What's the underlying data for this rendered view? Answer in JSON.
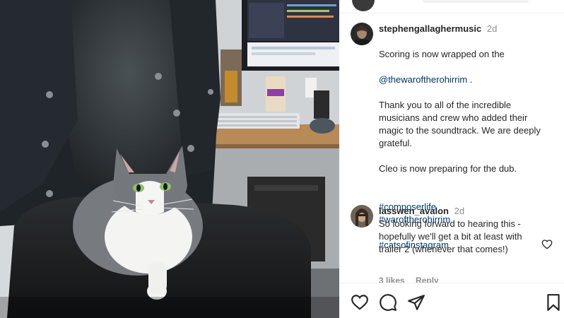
{
  "post": {
    "photo_alt": "",
    "caption": {
      "username": "stephengallaghermusic",
      "age": "2d",
      "line1": "Scoring is now wrapped on the",
      "mention": "@thewaroftherohirrim",
      "mention_suffix": " .",
      "para2": "Thank you to all of the incredible musicians and crew who added their magic to the soundtrack. We are deeply grateful.",
      "para3": "Cleo is now preparing for the dub.",
      "tags": [
        "#composerlife",
        "#waroftherohirrim",
        "#catsofinstagram"
      ]
    },
    "comment": {
      "username": "lasswen_avalon",
      "age": "2d",
      "text": "So looking forward to hearing this - hopefully we'll get a bit at least with trailer 2 (whenever that comes!)",
      "likes": "3 likes",
      "reply": "Reply"
    },
    "icons": {
      "like": "heart-icon",
      "comment": "comment-icon",
      "share": "send-icon",
      "save": "bookmark-icon",
      "comment_like": "heart-icon"
    },
    "colors": {
      "link": "#00376b",
      "muted": "#8e8e8e",
      "text": "#262626"
    }
  }
}
